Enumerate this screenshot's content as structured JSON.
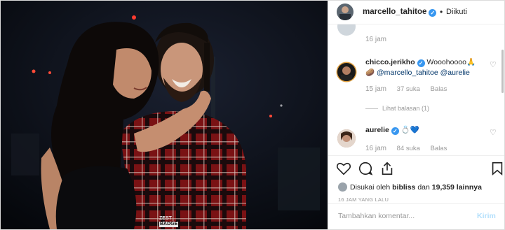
{
  "post": {
    "author": "marcello_tahitoe",
    "follow_dot": "•",
    "follow_label": "Diikuti",
    "verified_mark": "✓",
    "photo_watermark_top": "ZEST",
    "photo_watermark_bottom": "BADGE"
  },
  "comments": {
    "first_time": "16 jam",
    "items": [
      {
        "user": "chicco.jerikho",
        "text_before": "Wooohoooo🙏",
        "text_line2_prefix": "🥔",
        "mention1": "@marcello_tahitoe",
        "mention2": "@aurelie",
        "time": "15 jam",
        "likes": "37 suka",
        "reply": "Balas",
        "view_replies": "Lihat balasan (1)"
      },
      {
        "user": "aurelie",
        "text": "💍💙",
        "time": "16 jam",
        "likes": "84 suka",
        "reply": "Balas"
      }
    ]
  },
  "likes": {
    "prefix": "Disukai oleh",
    "user": "bibliss",
    "middle": "dan",
    "count": "19,359 lainnya"
  },
  "timestamp": "16 JAM YANG LALU",
  "add_comment": {
    "placeholder": "Tambahkan komentar...",
    "post_label": "Kirim"
  },
  "colors": {
    "verified": "#3897f0",
    "link": "#003569",
    "muted": "#999999",
    "post_button_disabled": "#b2dffc"
  }
}
